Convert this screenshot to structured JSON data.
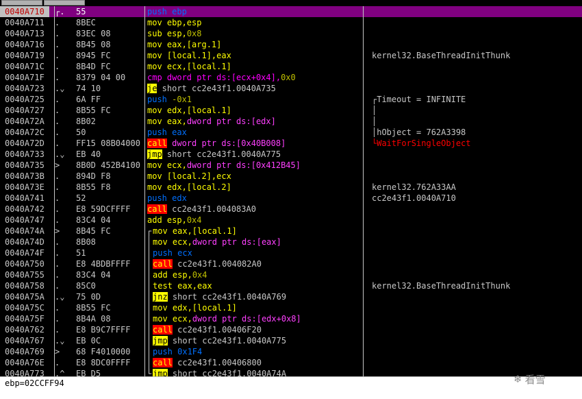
{
  "status_text": "ebp=02CCFF94",
  "watermark": {
    "text": "看雪",
    "icon": "snowflake-icon"
  },
  "rows": [
    {
      "addr": "0040A710",
      "mark": "┌.",
      "hex": "55",
      "ins": [
        {
          "t": "push",
          "c": "kw-push"
        },
        {
          "t": " ebp",
          "c": "kw-push"
        }
      ],
      "cmt": "",
      "sel": true
    },
    {
      "addr": "0040A711",
      "mark": ".",
      "hex": "8BEC",
      "ins": [
        {
          "t": "mov",
          "c": "mn"
        },
        {
          "t": " ebp,esp",
          "c": "ops"
        }
      ],
      "cmt": ""
    },
    {
      "addr": "0040A713",
      "mark": ".",
      "hex": "83EC 08",
      "ins": [
        {
          "t": "sub",
          "c": "mn"
        },
        {
          "t": " esp,",
          "c": "ops"
        },
        {
          "t": "0x8",
          "c": "c-olive"
        }
      ],
      "cmt": ""
    },
    {
      "addr": "0040A716",
      "mark": ".",
      "hex": "8B45 08",
      "ins": [
        {
          "t": "mov",
          "c": "mn"
        },
        {
          "t": " eax,[arg.1]",
          "c": "ops"
        }
      ],
      "cmt": ""
    },
    {
      "addr": "0040A719",
      "mark": ".",
      "hex": "8945 FC",
      "ins": [
        {
          "t": "mov",
          "c": "mn"
        },
        {
          "t": " [local.1],eax",
          "c": "ops"
        }
      ],
      "cmt": "kernel32.BaseThreadInitThunk"
    },
    {
      "addr": "0040A71C",
      "mark": ".",
      "hex": "8B4D FC",
      "ins": [
        {
          "t": "mov",
          "c": "mn"
        },
        {
          "t": " ecx,[local.1]",
          "c": "ops"
        }
      ],
      "cmt": ""
    },
    {
      "addr": "0040A71F",
      "mark": ".",
      "hex": "8379 04 00",
      "ins": [
        {
          "t": "cmp",
          "c": "kw-cmp"
        },
        {
          "t": " dword ptr ds:[ecx+0x4],",
          "c": "kw-cmp"
        },
        {
          "t": "0x0",
          "c": "c-olive"
        }
      ],
      "cmt": ""
    },
    {
      "addr": "0040A723",
      "mark": ".⌄",
      "hex": "74 10",
      "ins": [
        {
          "t": "je",
          "c": "kw-jmp"
        },
        {
          "t": " short cc2e43f1.0040A735",
          "c": ""
        }
      ],
      "cmt": ""
    },
    {
      "addr": "0040A725",
      "mark": ".",
      "hex": "6A FF",
      "ins": [
        {
          "t": "push",
          "c": "kw-push"
        },
        {
          "t": " -0x1",
          "c": "c-olive"
        }
      ],
      "cmt": "┌Timeout = INFINITE"
    },
    {
      "addr": "0040A727",
      "mark": ".",
      "hex": "8B55 FC",
      "ins": [
        {
          "t": "mov",
          "c": "mn"
        },
        {
          "t": " edx,[local.1]",
          "c": "ops"
        }
      ],
      "cmt": "│"
    },
    {
      "addr": "0040A72A",
      "mark": ".",
      "hex": "8B02",
      "ins": [
        {
          "t": "mov",
          "c": "mn"
        },
        {
          "t": " eax,",
          "c": "ops"
        },
        {
          "t": "dword ptr ds:[edx]",
          "c": "c-pink"
        }
      ],
      "cmt": "│"
    },
    {
      "addr": "0040A72C",
      "mark": ".",
      "hex": "50",
      "ins": [
        {
          "t": "push",
          "c": "kw-push"
        },
        {
          "t": " eax",
          "c": "kw-push"
        }
      ],
      "cmt": "│hObject = 762A3398"
    },
    {
      "addr": "0040A72D",
      "mark": ".",
      "hex": "FF15 08B04000",
      "ins": [
        {
          "t": "call",
          "c": "kw-call"
        },
        {
          "t": " dword ptr ds:[0x40B008]",
          "c": "c-pink"
        }
      ],
      "cmt": "└WaitForSingleObject",
      "cmtc": "c-red"
    },
    {
      "addr": "0040A733",
      "mark": ".⌄",
      "hex": "EB 40",
      "ins": [
        {
          "t": "jmp",
          "c": "kw-jmp"
        },
        {
          "t": " short cc2e43f1.0040A775",
          "c": ""
        }
      ],
      "cmt": ""
    },
    {
      "addr": "0040A735",
      "mark": ">",
      "hex": "8B0D 452B4100",
      "ins": [
        {
          "t": "mov",
          "c": "mn"
        },
        {
          "t": " ecx,",
          "c": "ops"
        },
        {
          "t": "dword ptr ds:[0x412B45]",
          "c": "c-pink"
        }
      ],
      "cmt": ""
    },
    {
      "addr": "0040A73B",
      "mark": ".",
      "hex": "894D F8",
      "ins": [
        {
          "t": "mov",
          "c": "mn"
        },
        {
          "t": " [local.2],ecx",
          "c": "ops"
        }
      ],
      "cmt": ""
    },
    {
      "addr": "0040A73E",
      "mark": ".",
      "hex": "8B55 F8",
      "ins": [
        {
          "t": "mov",
          "c": "mn"
        },
        {
          "t": " edx,[local.2]",
          "c": "ops"
        }
      ],
      "cmt": "kernel32.762A33AA"
    },
    {
      "addr": "0040A741",
      "mark": ".",
      "hex": "52",
      "ins": [
        {
          "t": "push",
          "c": "kw-push"
        },
        {
          "t": " edx",
          "c": "kw-push"
        }
      ],
      "cmt": "cc2e43f1.0040A710"
    },
    {
      "addr": "0040A742",
      "mark": ".",
      "hex": "E8 59DCFFFF",
      "ins": [
        {
          "t": "call",
          "c": "kw-call"
        },
        {
          "t": " cc2e43f1.004083A0",
          "c": ""
        }
      ],
      "cmt": ""
    },
    {
      "addr": "0040A747",
      "mark": ".",
      "hex": "83C4 04",
      "ins": [
        {
          "t": "add",
          "c": "mn"
        },
        {
          "t": " esp,",
          "c": "ops"
        },
        {
          "t": "0x4",
          "c": "c-olive"
        }
      ],
      "cmt": ""
    },
    {
      "addr": "0040A74A",
      "mark": ">",
      "hex": "8B45 FC",
      "ins": [
        {
          "t": "mov",
          "c": "mn"
        },
        {
          "t": " eax,[local.1]",
          "c": "ops"
        }
      ],
      "cmt": "",
      "ind": true,
      "brk": "┌"
    },
    {
      "addr": "0040A74D",
      "mark": ".",
      "hex": "8B08",
      "ins": [
        {
          "t": "mov",
          "c": "mn"
        },
        {
          "t": " ecx,",
          "c": "ops"
        },
        {
          "t": "dword ptr ds:[eax]",
          "c": "c-pink"
        }
      ],
      "cmt": "",
      "ind": true
    },
    {
      "addr": "0040A74F",
      "mark": ".",
      "hex": "51",
      "ins": [
        {
          "t": "push",
          "c": "kw-push"
        },
        {
          "t": " ecx",
          "c": "kw-push"
        }
      ],
      "cmt": "",
      "ind": true
    },
    {
      "addr": "0040A750",
      "mark": ".",
      "hex": "E8 4BDBFFFF",
      "ins": [
        {
          "t": "call",
          "c": "kw-call"
        },
        {
          "t": " cc2e43f1.004082A0",
          "c": ""
        }
      ],
      "cmt": "",
      "ind": true
    },
    {
      "addr": "0040A755",
      "mark": ".",
      "hex": "83C4 04",
      "ins": [
        {
          "t": "add",
          "c": "mn"
        },
        {
          "t": " esp,",
          "c": "ops"
        },
        {
          "t": "0x4",
          "c": "c-olive"
        }
      ],
      "cmt": "",
      "ind": true
    },
    {
      "addr": "0040A758",
      "mark": ".",
      "hex": "85C0",
      "ins": [
        {
          "t": "test",
          "c": "mn"
        },
        {
          "t": " eax,eax",
          "c": "ops"
        }
      ],
      "cmt": "kernel32.BaseThreadInitThunk",
      "ind": true
    },
    {
      "addr": "0040A75A",
      "mark": ".⌄",
      "hex": "75 0D",
      "ins": [
        {
          "t": "jnz",
          "c": "kw-jmp"
        },
        {
          "t": " short cc2e43f1.0040A769",
          "c": ""
        }
      ],
      "cmt": "",
      "ind": true
    },
    {
      "addr": "0040A75C",
      "mark": ".",
      "hex": "8B55 FC",
      "ins": [
        {
          "t": "mov",
          "c": "mn"
        },
        {
          "t": " edx,[local.1]",
          "c": "ops"
        }
      ],
      "cmt": "",
      "ind": true
    },
    {
      "addr": "0040A75F",
      "mark": ".",
      "hex": "8B4A 08",
      "ins": [
        {
          "t": "mov",
          "c": "mn"
        },
        {
          "t": " ecx,",
          "c": "ops"
        },
        {
          "t": "dword ptr ds:[edx+0x8]",
          "c": "c-pink"
        }
      ],
      "cmt": "",
      "ind": true
    },
    {
      "addr": "0040A762",
      "mark": ".",
      "hex": "E8 B9C7FFFF",
      "ins": [
        {
          "t": "call",
          "c": "kw-call"
        },
        {
          "t": " cc2e43f1.00406F20",
          "c": ""
        }
      ],
      "cmt": "",
      "ind": true
    },
    {
      "addr": "0040A767",
      "mark": ".⌄",
      "hex": "EB 0C",
      "ins": [
        {
          "t": "jmp",
          "c": "kw-jmp"
        },
        {
          "t": " short cc2e43f1.0040A775",
          "c": ""
        }
      ],
      "cmt": "",
      "ind": true
    },
    {
      "addr": "0040A769",
      "mark": ">",
      "hex": "68 F4010000",
      "ins": [
        {
          "t": "push",
          "c": "kw-push"
        },
        {
          "t": " 0x1F4",
          "c": "kw-push"
        }
      ],
      "cmt": "",
      "ind": true
    },
    {
      "addr": "0040A76E",
      "mark": ".",
      "hex": "E8 8DC0FFFF",
      "ins": [
        {
          "t": "call",
          "c": "kw-call"
        },
        {
          "t": " cc2e43f1.00406800",
          "c": ""
        }
      ],
      "cmt": "",
      "ind": true
    },
    {
      "addr": "0040A773",
      "mark": ".^",
      "hex": "EB D5",
      "ins": [
        {
          "t": "jmp",
          "c": "kw-jmp"
        },
        {
          "t": " short cc2e43f1.0040A74A",
          "c": ""
        }
      ],
      "cmt": "",
      "ind": true,
      "brk": "└"
    }
  ]
}
